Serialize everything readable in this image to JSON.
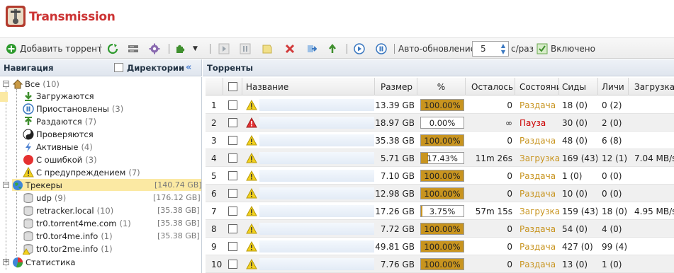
{
  "app": {
    "title": "Transmission"
  },
  "toolbar": {
    "add_label": "Добавить торрент",
    "autorefresh_label": "Авто-обновление:",
    "interval_value": "5",
    "interval_unit": "с/раз",
    "enabled_label": "Включено",
    "colors": {
      "green_icon": "#2e9a2e",
      "red_icon": "#d23a3a",
      "gray_icon": "#9aa4ad"
    }
  },
  "nav": {
    "title": "Навигация",
    "directories_label": "Директории",
    "tree": {
      "all": {
        "label": "Все",
        "count": "(10)"
      },
      "status": [
        {
          "label": "Загружаются",
          "count": ""
        },
        {
          "label": "Приостановлены",
          "count": "(3)"
        },
        {
          "label": "Раздаются",
          "count": "(7)"
        },
        {
          "label": "Проверяются",
          "count": ""
        },
        {
          "label": "Активные",
          "count": "(4)"
        },
        {
          "label": "С ошибкой",
          "count": "(3)"
        },
        {
          "label": "С предупреждением",
          "count": "(7)"
        }
      ],
      "trackers": {
        "label": "Трекеры",
        "size": "[140.74 GB]"
      },
      "tracker_items": [
        {
          "label": "udp",
          "count": "(9)",
          "size": "[176.12 GB]"
        },
        {
          "label": "retracker.local",
          "count": "(10)",
          "size": "[35.38 GB]"
        },
        {
          "label": "tr0.torrent4me.com",
          "count": "(1)",
          "size": "[35.38 GB]"
        },
        {
          "label": "tr0.tor4me.info",
          "count": "(1)",
          "size": "[35.38 GB]"
        },
        {
          "label": "tr0.tor2me.info",
          "count": "(1)",
          "size": ""
        }
      ],
      "stats": {
        "label": "Статистика"
      }
    }
  },
  "main": {
    "title": "Торренты",
    "columns": [
      "Название",
      "Размер",
      "%",
      "Осталось",
      "Состояни",
      "Сиды",
      "Личи",
      "Загрузка"
    ],
    "rows": [
      {
        "n": "1",
        "size": "13.39 GB",
        "pct": "100.00%",
        "pct_value": 100,
        "left": "0",
        "state": "Раздача",
        "state_kind": "seed",
        "seeds": "18 (0)",
        "leech": "0 (2)",
        "speed": "",
        "icon": "warn"
      },
      {
        "n": "2",
        "size": "18.97 GB",
        "pct": "0.00%",
        "pct_value": 0,
        "left": "∞",
        "state": "Пауза",
        "state_kind": "pause",
        "seeds": "30 (0)",
        "leech": "2 (0)",
        "speed": "",
        "icon": "error"
      },
      {
        "n": "3",
        "size": "35.38 GB",
        "pct": "100.00%",
        "pct_value": 100,
        "left": "0",
        "state": "Раздача",
        "state_kind": "seed",
        "seeds": "48 (0)",
        "leech": "6 (8)",
        "speed": "",
        "icon": "warn"
      },
      {
        "n": "4",
        "size": "5.71 GB",
        "pct": "17.43%",
        "pct_value": 17.43,
        "left": "11m 26s",
        "state": "Загрузка",
        "state_kind": "dl",
        "seeds": "169 (43)",
        "leech": "12 (1)",
        "speed": "7.04 MB/s",
        "icon": "warn"
      },
      {
        "n": "5",
        "size": "7.10 GB",
        "pct": "100.00%",
        "pct_value": 100,
        "left": "0",
        "state": "Раздача",
        "state_kind": "seed",
        "seeds": "1 (0)",
        "leech": "0 (0)",
        "speed": "",
        "icon": "warn"
      },
      {
        "n": "6",
        "size": "12.98 GB",
        "pct": "100.00%",
        "pct_value": 100,
        "left": "0",
        "state": "Раздача",
        "state_kind": "seed",
        "seeds": "10 (0)",
        "leech": "0 (0)",
        "speed": "",
        "icon": "warn"
      },
      {
        "n": "7",
        "size": "17.26 GB",
        "pct": "3.75%",
        "pct_value": 3.75,
        "left": "57m 15s",
        "state": "Загрузка",
        "state_kind": "dl",
        "seeds": "159 (43)",
        "leech": "18 (0)",
        "speed": "4.95 MB/s",
        "icon": "warn"
      },
      {
        "n": "8",
        "size": "7.72 GB",
        "pct": "100.00%",
        "pct_value": 100,
        "left": "0",
        "state": "Раздача",
        "state_kind": "seed",
        "seeds": "54 (0)",
        "leech": "4 (0)",
        "speed": "",
        "icon": "warn"
      },
      {
        "n": "9",
        "size": "49.81 GB",
        "pct": "100.00%",
        "pct_value": 100,
        "left": "0",
        "state": "Раздача",
        "state_kind": "seed",
        "seeds": "427 (0)",
        "leech": "99 (4)",
        "speed": "",
        "icon": "warn"
      },
      {
        "n": "10",
        "size": "7.76 GB",
        "pct": "100.00%",
        "pct_value": 100,
        "left": "0",
        "state": "Раздача",
        "state_kind": "seed",
        "seeds": "13 (0)",
        "leech": "1 (0)",
        "speed": "",
        "icon": "warn"
      }
    ]
  }
}
